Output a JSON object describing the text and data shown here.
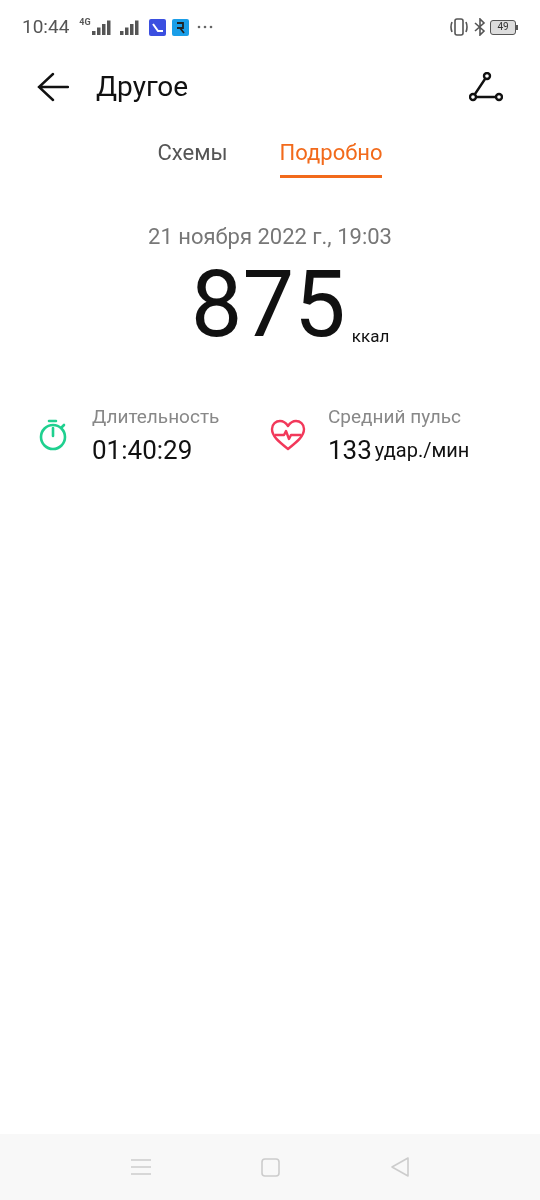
{
  "status_bar": {
    "time": "10:44",
    "network": "4G",
    "battery": "49"
  },
  "header": {
    "title": "Другое"
  },
  "tabs": [
    {
      "label": "Схемы",
      "selected": false
    },
    {
      "label": "Подробно",
      "selected": true
    }
  ],
  "workout": {
    "datetime": "21 ноября 2022 г., 19:03",
    "calories": "875",
    "calories_unit": "ккал"
  },
  "stats": [
    {
      "kind": "duration",
      "label": "Длительность",
      "value": "01:40:29"
    },
    {
      "kind": "heart",
      "label": "Средний пульс",
      "value": "133",
      "unit": "удар./мин"
    }
  ]
}
